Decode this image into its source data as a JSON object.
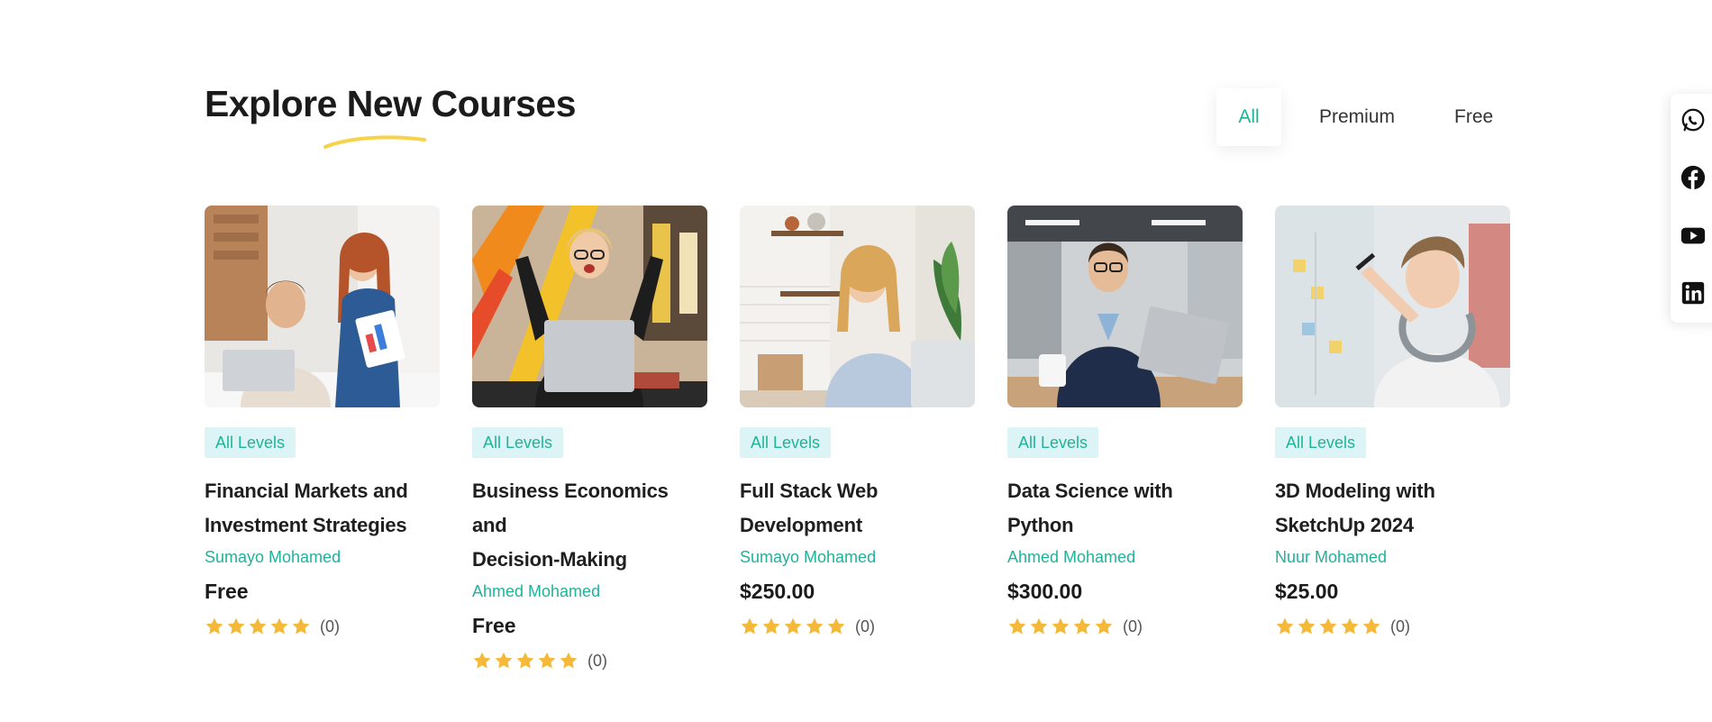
{
  "section": {
    "title": "Explore New Courses"
  },
  "filters": {
    "all": "All",
    "premium": "Premium",
    "free": "Free",
    "active": "All"
  },
  "colors": {
    "accent": "#1fb39a",
    "level_bg": "#ddf4f6",
    "star": "#f5b93a",
    "underline": "#f7d34a"
  },
  "social": [
    "whatsapp-icon",
    "facebook-icon",
    "youtube-icon",
    "linkedin-icon"
  ],
  "courses": [
    {
      "level": "All Levels",
      "title_line1": "Financial Markets and",
      "title_line2": "Investment Strategies",
      "instructor": "Sumayo Mohamed",
      "price": "Free",
      "rating": 5,
      "reviews": "(0)"
    },
    {
      "level": "All Levels",
      "title_line1": "Business Economics and",
      "title_line2": "Decision-Making",
      "instructor": "Ahmed Mohamed",
      "price": "Free",
      "rating": 5,
      "reviews": "(0)"
    },
    {
      "level": "All Levels",
      "title_line1": "Full Stack Web",
      "title_line2": "Development",
      "instructor": "Sumayo Mohamed",
      "price": "$250.00",
      "rating": 5,
      "reviews": "(0)"
    },
    {
      "level": "All Levels",
      "title_line1": "Data Science with Python",
      "title_line2": "",
      "instructor": "Ahmed Mohamed",
      "price": "$300.00",
      "rating": 5,
      "reviews": "(0)"
    },
    {
      "level": "All Levels",
      "title_line1": "3D Modeling with",
      "title_line2": "SketchUp 2024",
      "instructor": "Nuur Mohamed",
      "price": "$25.00",
      "rating": 5,
      "reviews": "(0)"
    }
  ]
}
